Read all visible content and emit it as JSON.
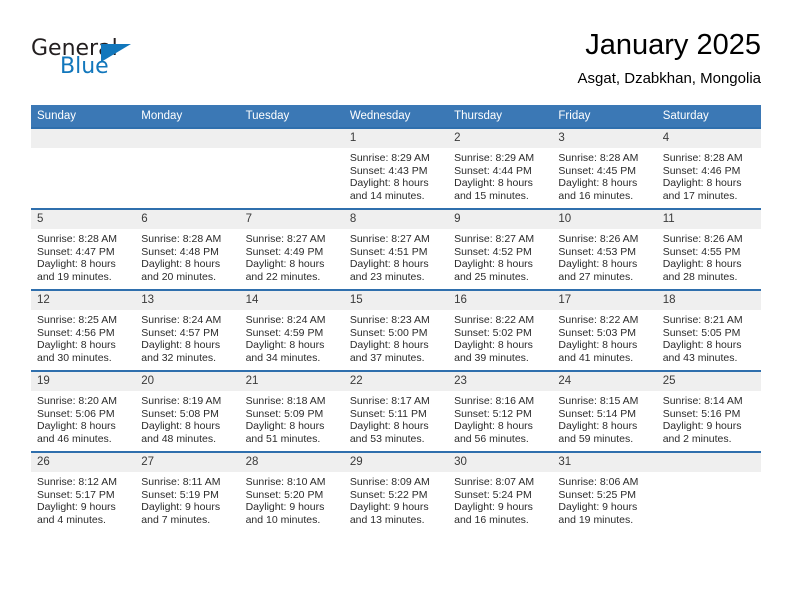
{
  "brand": {
    "name_part1": "General",
    "name_part2": "Blue",
    "accent_color": "#1277bc"
  },
  "header": {
    "title": "January 2025",
    "location": "Asgat, Dzabkhan, Mongolia",
    "header_bg_color": "#3b78b5",
    "cell_band_color": "#efefef"
  },
  "weekday_headers": [
    "Sunday",
    "Monday",
    "Tuesday",
    "Wednesday",
    "Thursday",
    "Friday",
    "Saturday"
  ],
  "weeks": [
    [
      {
        "day": "",
        "sunrise": "",
        "sunset": "",
        "daylight_line1": "",
        "daylight_line2": ""
      },
      {
        "day": "",
        "sunrise": "",
        "sunset": "",
        "daylight_line1": "",
        "daylight_line2": ""
      },
      {
        "day": "",
        "sunrise": "",
        "sunset": "",
        "daylight_line1": "",
        "daylight_line2": ""
      },
      {
        "day": "1",
        "sunrise": "Sunrise: 8:29 AM",
        "sunset": "Sunset: 4:43 PM",
        "daylight_line1": "Daylight: 8 hours",
        "daylight_line2": "and 14 minutes."
      },
      {
        "day": "2",
        "sunrise": "Sunrise: 8:29 AM",
        "sunset": "Sunset: 4:44 PM",
        "daylight_line1": "Daylight: 8 hours",
        "daylight_line2": "and 15 minutes."
      },
      {
        "day": "3",
        "sunrise": "Sunrise: 8:28 AM",
        "sunset": "Sunset: 4:45 PM",
        "daylight_line1": "Daylight: 8 hours",
        "daylight_line2": "and 16 minutes."
      },
      {
        "day": "4",
        "sunrise": "Sunrise: 8:28 AM",
        "sunset": "Sunset: 4:46 PM",
        "daylight_line1": "Daylight: 8 hours",
        "daylight_line2": "and 17 minutes."
      }
    ],
    [
      {
        "day": "5",
        "sunrise": "Sunrise: 8:28 AM",
        "sunset": "Sunset: 4:47 PM",
        "daylight_line1": "Daylight: 8 hours",
        "daylight_line2": "and 19 minutes."
      },
      {
        "day": "6",
        "sunrise": "Sunrise: 8:28 AM",
        "sunset": "Sunset: 4:48 PM",
        "daylight_line1": "Daylight: 8 hours",
        "daylight_line2": "and 20 minutes."
      },
      {
        "day": "7",
        "sunrise": "Sunrise: 8:27 AM",
        "sunset": "Sunset: 4:49 PM",
        "daylight_line1": "Daylight: 8 hours",
        "daylight_line2": "and 22 minutes."
      },
      {
        "day": "8",
        "sunrise": "Sunrise: 8:27 AM",
        "sunset": "Sunset: 4:51 PM",
        "daylight_line1": "Daylight: 8 hours",
        "daylight_line2": "and 23 minutes."
      },
      {
        "day": "9",
        "sunrise": "Sunrise: 8:27 AM",
        "sunset": "Sunset: 4:52 PM",
        "daylight_line1": "Daylight: 8 hours",
        "daylight_line2": "and 25 minutes."
      },
      {
        "day": "10",
        "sunrise": "Sunrise: 8:26 AM",
        "sunset": "Sunset: 4:53 PM",
        "daylight_line1": "Daylight: 8 hours",
        "daylight_line2": "and 27 minutes."
      },
      {
        "day": "11",
        "sunrise": "Sunrise: 8:26 AM",
        "sunset": "Sunset: 4:55 PM",
        "daylight_line1": "Daylight: 8 hours",
        "daylight_line2": "and 28 minutes."
      }
    ],
    [
      {
        "day": "12",
        "sunrise": "Sunrise: 8:25 AM",
        "sunset": "Sunset: 4:56 PM",
        "daylight_line1": "Daylight: 8 hours",
        "daylight_line2": "and 30 minutes."
      },
      {
        "day": "13",
        "sunrise": "Sunrise: 8:24 AM",
        "sunset": "Sunset: 4:57 PM",
        "daylight_line1": "Daylight: 8 hours",
        "daylight_line2": "and 32 minutes."
      },
      {
        "day": "14",
        "sunrise": "Sunrise: 8:24 AM",
        "sunset": "Sunset: 4:59 PM",
        "daylight_line1": "Daylight: 8 hours",
        "daylight_line2": "and 34 minutes."
      },
      {
        "day": "15",
        "sunrise": "Sunrise: 8:23 AM",
        "sunset": "Sunset: 5:00 PM",
        "daylight_line1": "Daylight: 8 hours",
        "daylight_line2": "and 37 minutes."
      },
      {
        "day": "16",
        "sunrise": "Sunrise: 8:22 AM",
        "sunset": "Sunset: 5:02 PM",
        "daylight_line1": "Daylight: 8 hours",
        "daylight_line2": "and 39 minutes."
      },
      {
        "day": "17",
        "sunrise": "Sunrise: 8:22 AM",
        "sunset": "Sunset: 5:03 PM",
        "daylight_line1": "Daylight: 8 hours",
        "daylight_line2": "and 41 minutes."
      },
      {
        "day": "18",
        "sunrise": "Sunrise: 8:21 AM",
        "sunset": "Sunset: 5:05 PM",
        "daylight_line1": "Daylight: 8 hours",
        "daylight_line2": "and 43 minutes."
      }
    ],
    [
      {
        "day": "19",
        "sunrise": "Sunrise: 8:20 AM",
        "sunset": "Sunset: 5:06 PM",
        "daylight_line1": "Daylight: 8 hours",
        "daylight_line2": "and 46 minutes."
      },
      {
        "day": "20",
        "sunrise": "Sunrise: 8:19 AM",
        "sunset": "Sunset: 5:08 PM",
        "daylight_line1": "Daylight: 8 hours",
        "daylight_line2": "and 48 minutes."
      },
      {
        "day": "21",
        "sunrise": "Sunrise: 8:18 AM",
        "sunset": "Sunset: 5:09 PM",
        "daylight_line1": "Daylight: 8 hours",
        "daylight_line2": "and 51 minutes."
      },
      {
        "day": "22",
        "sunrise": "Sunrise: 8:17 AM",
        "sunset": "Sunset: 5:11 PM",
        "daylight_line1": "Daylight: 8 hours",
        "daylight_line2": "and 53 minutes."
      },
      {
        "day": "23",
        "sunrise": "Sunrise: 8:16 AM",
        "sunset": "Sunset: 5:12 PM",
        "daylight_line1": "Daylight: 8 hours",
        "daylight_line2": "and 56 minutes."
      },
      {
        "day": "24",
        "sunrise": "Sunrise: 8:15 AM",
        "sunset": "Sunset: 5:14 PM",
        "daylight_line1": "Daylight: 8 hours",
        "daylight_line2": "and 59 minutes."
      },
      {
        "day": "25",
        "sunrise": "Sunrise: 8:14 AM",
        "sunset": "Sunset: 5:16 PM",
        "daylight_line1": "Daylight: 9 hours",
        "daylight_line2": "and 2 minutes."
      }
    ],
    [
      {
        "day": "26",
        "sunrise": "Sunrise: 8:12 AM",
        "sunset": "Sunset: 5:17 PM",
        "daylight_line1": "Daylight: 9 hours",
        "daylight_line2": "and 4 minutes."
      },
      {
        "day": "27",
        "sunrise": "Sunrise: 8:11 AM",
        "sunset": "Sunset: 5:19 PM",
        "daylight_line1": "Daylight: 9 hours",
        "daylight_line2": "and 7 minutes."
      },
      {
        "day": "28",
        "sunrise": "Sunrise: 8:10 AM",
        "sunset": "Sunset: 5:20 PM",
        "daylight_line1": "Daylight: 9 hours",
        "daylight_line2": "and 10 minutes."
      },
      {
        "day": "29",
        "sunrise": "Sunrise: 8:09 AM",
        "sunset": "Sunset: 5:22 PM",
        "daylight_line1": "Daylight: 9 hours",
        "daylight_line2": "and 13 minutes."
      },
      {
        "day": "30",
        "sunrise": "Sunrise: 8:07 AM",
        "sunset": "Sunset: 5:24 PM",
        "daylight_line1": "Daylight: 9 hours",
        "daylight_line2": "and 16 minutes."
      },
      {
        "day": "31",
        "sunrise": "Sunrise: 8:06 AM",
        "sunset": "Sunset: 5:25 PM",
        "daylight_line1": "Daylight: 9 hours",
        "daylight_line2": "and 19 minutes."
      },
      {
        "day": "",
        "sunrise": "",
        "sunset": "",
        "daylight_line1": "",
        "daylight_line2": ""
      }
    ]
  ]
}
